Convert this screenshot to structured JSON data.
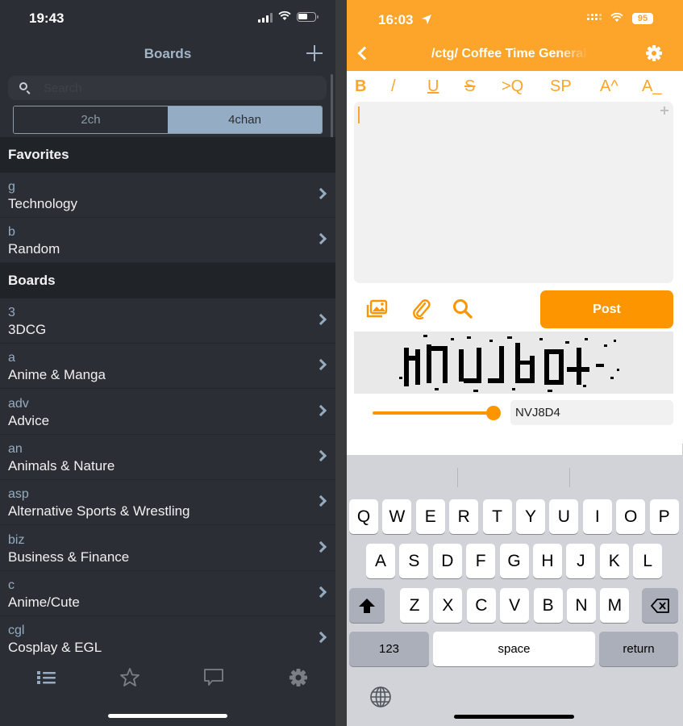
{
  "left": {
    "status": {
      "time": "19:43"
    },
    "nav": {
      "title": "Boards"
    },
    "search": {
      "placeholder": "Search",
      "value": ""
    },
    "segments": [
      {
        "label": "2ch",
        "active": false
      },
      {
        "label": "4chan",
        "active": true
      }
    ],
    "sections": {
      "favorites": {
        "title": "Favorites",
        "items": [
          {
            "code": "g",
            "name": "Technology"
          },
          {
            "code": "b",
            "name": "Random"
          }
        ]
      },
      "boards": {
        "title": "Boards",
        "items": [
          {
            "code": "3",
            "name": "3DCG"
          },
          {
            "code": "a",
            "name": "Anime & Manga"
          },
          {
            "code": "adv",
            "name": "Advice"
          },
          {
            "code": "an",
            "name": "Animals & Nature"
          },
          {
            "code": "asp",
            "name": "Alternative Sports & Wrestling"
          },
          {
            "code": "biz",
            "name": "Business & Finance"
          },
          {
            "code": "c",
            "name": "Anime/Cute"
          },
          {
            "code": "cgl",
            "name": "Cosplay & EGL"
          }
        ]
      }
    },
    "tabbar": [
      {
        "icon": "list-icon",
        "active": true
      },
      {
        "icon": "star-icon",
        "active": false
      },
      {
        "icon": "chat-bubble-icon",
        "active": false
      },
      {
        "icon": "gear-icon",
        "active": false
      }
    ],
    "colors": {
      "background": "#2b2f35",
      "accent": "#97abbf",
      "section": "#202327"
    }
  },
  "right": {
    "status": {
      "time": "16:03",
      "battery": "95"
    },
    "nav": {
      "title": "/ctg/ Coffee Time General"
    },
    "format_buttons": [
      "B",
      "/",
      "U",
      "S",
      ">Q",
      "SP",
      "A^",
      "A_"
    ],
    "editor": {
      "value": ""
    },
    "actions": {
      "post_label": "Post"
    },
    "captcha": {
      "slider_value": 1.0,
      "input_value": "NVJ8D4"
    },
    "keyboard": {
      "rows": [
        [
          "Q",
          "W",
          "E",
          "R",
          "T",
          "Y",
          "U",
          "I",
          "O",
          "P"
        ],
        [
          "A",
          "S",
          "D",
          "F",
          "G",
          "H",
          "J",
          "K",
          "L"
        ],
        [
          "Z",
          "X",
          "C",
          "V",
          "B",
          "N",
          "M"
        ]
      ],
      "numbers_label": "123",
      "space_label": "space",
      "return_label": "return"
    },
    "colors": {
      "header": "#fda42a",
      "accent": "#fd9500"
    }
  }
}
